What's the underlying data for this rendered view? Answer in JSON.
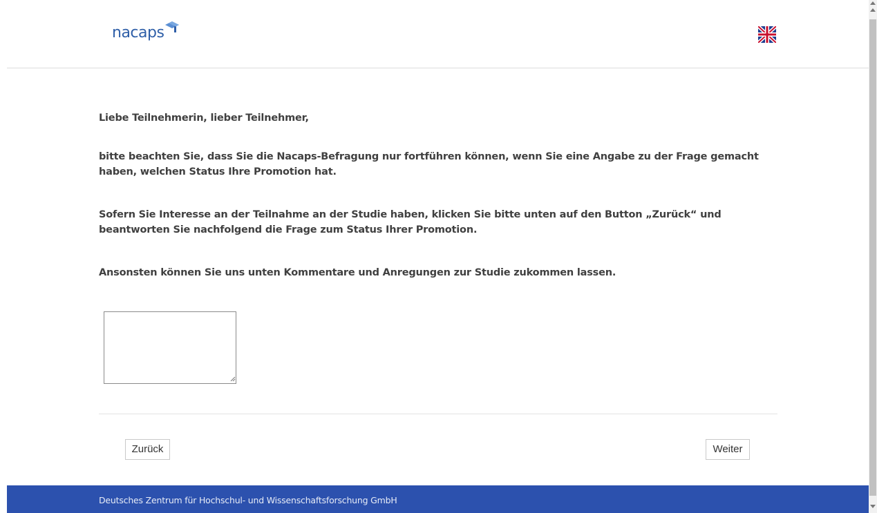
{
  "header": {
    "logo_text": "nacaps",
    "language_flag": "uk-flag-icon"
  },
  "main": {
    "greeting": "Liebe Teilnehmerin, lieber Teilnehmer,",
    "paragraph1": "bitte beachten Sie, dass Sie die Nacaps-Befragung nur fortführen können, wenn Sie eine Angabe zu der Frage gemacht haben, welchen Status Ihre Promotion hat.",
    "paragraph2": "Sofern Sie Interesse an der Teilnahme an der Studie haben, klicken Sie bitte unten auf den Button „Zurück“ und beantworten Sie nachfolgend die Frage zum Status Ihrer Promotion.",
    "paragraph3": "Ansonsten können Sie uns unten Kommentare und Anregungen zur Studie zukommen lassen.",
    "comment_value": ""
  },
  "nav": {
    "back_label": "Zurück",
    "next_label": "Weiter"
  },
  "footer": {
    "text": "Deutsches Zentrum für Hochschul- und Wissenschaftsforschung GmbH"
  },
  "colors": {
    "brand_blue": "#2f5fa8",
    "footer_bg": "#2c51ae",
    "text": "#404040"
  }
}
